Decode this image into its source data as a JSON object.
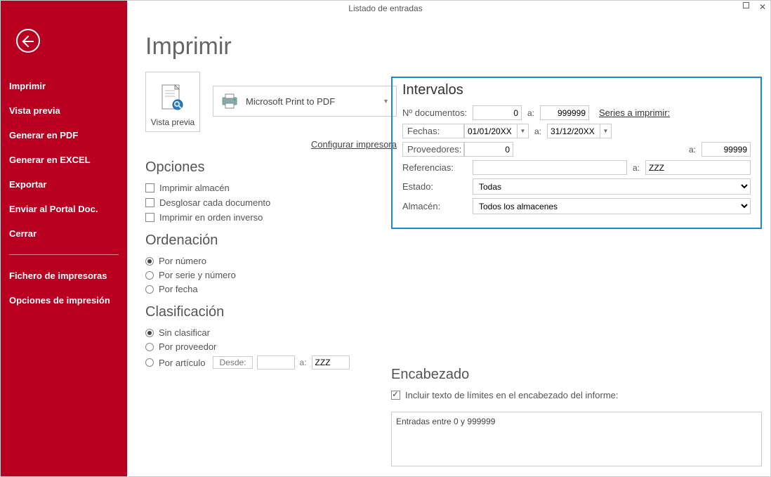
{
  "window": {
    "title": "Listado de entradas"
  },
  "sidebar": {
    "items": [
      "Imprimir",
      "Vista previa",
      "Generar en PDF",
      "Generar en EXCEL",
      "Exportar",
      "Enviar al Portal Doc.",
      "Cerrar"
    ],
    "items2": [
      "Fichero de impresoras",
      "Opciones de impresión"
    ]
  },
  "page_title": "Imprimir",
  "preview_label": "Vista previa",
  "printer_name": "Microsoft Print to PDF",
  "configure_link": "Configurar impresora",
  "opciones": {
    "title": "Opciones",
    "imprimir_almacen": "Imprimir almacén",
    "desglosar": "Desglosar cada documento",
    "orden_inverso": "Imprimir en orden inverso"
  },
  "ordenacion": {
    "title": "Ordenación",
    "por_numero": "Por número",
    "por_serie": "Por serie y número",
    "por_fecha": "Por fecha"
  },
  "clasificacion": {
    "title": "Clasificación",
    "sin_clasificar": "Sin clasificar",
    "por_proveedor": "Por proveedor",
    "por_articulo": "Por artículo",
    "desde_label": "Desde:",
    "a_label": "a:",
    "desde_value": "",
    "a_value": "ZZZ"
  },
  "intervalos": {
    "title": "Intervalos",
    "n_documentos_label": "Nº documentos:",
    "n_doc_from": "0",
    "n_doc_to": "999999",
    "a_label": "a:",
    "series_link": "Series a imprimir:",
    "fechas_label": "Fechas:",
    "fecha_from": "01/01/20XX",
    "fecha_to": "31/12/20XX",
    "proveedores_label": "Proveedores:",
    "prov_from": "0",
    "prov_to": "99999",
    "referencias_label": "Referencias:",
    "ref_from": "",
    "ref_to": "ZZZ",
    "estado_label": "Estado:",
    "estado_value": "Todas",
    "almacen_label": "Almacén:",
    "almacen_value": "Todos los almacenes"
  },
  "encabezado": {
    "title": "Encabezado",
    "incluir_label": "Incluir texto de límites en el encabezado del informe:",
    "text": "Entradas entre 0 y 999999"
  }
}
